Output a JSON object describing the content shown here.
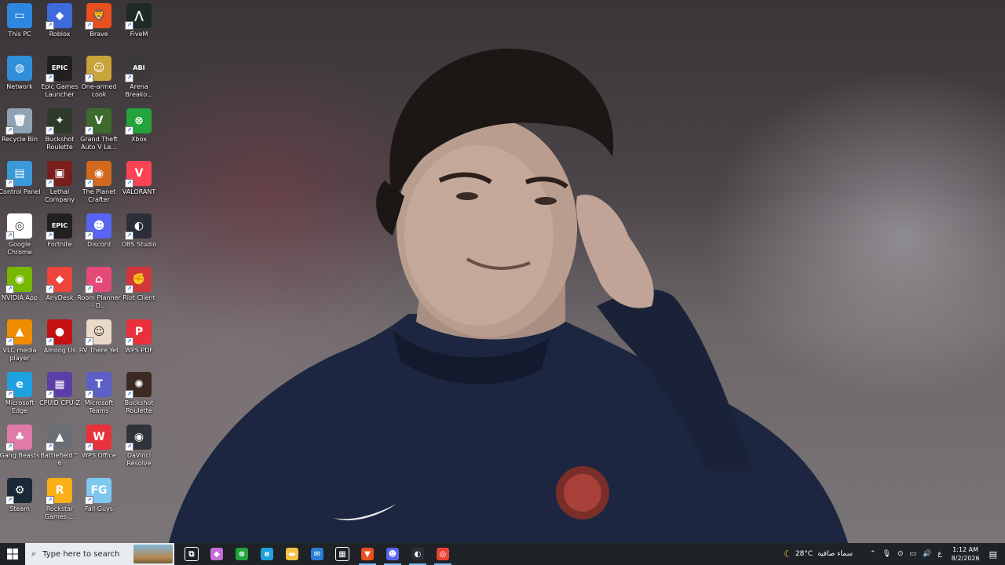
{
  "desktop": {
    "icons": [
      {
        "label": "This PC",
        "icon": "this-pc-icon",
        "color": "#2e86de",
        "glyph": "▭"
      },
      {
        "label": "Roblox",
        "icon": "roblox-icon",
        "color": "#3d6bdb",
        "glyph": "◆"
      },
      {
        "label": "Brave",
        "icon": "brave-icon",
        "color": "#e8501e",
        "glyph": "🦁"
      },
      {
        "label": "FiveM",
        "icon": "fivem-icon",
        "color": "#1d2a25",
        "glyph": "⋀"
      },
      {
        "label": "Network",
        "icon": "network-icon",
        "color": "#2f8fd8",
        "glyph": "◍"
      },
      {
        "label": "Epic Games Launcher",
        "icon": "epic-games-icon",
        "color": "#202020",
        "glyph": "EPIC"
      },
      {
        "label": "One-armed cook",
        "icon": "one-armed-cook-icon",
        "color": "#c9a43a",
        "glyph": "☺"
      },
      {
        "label": "Arena Breako...",
        "icon": "arena-breakout-icon",
        "color": "#3a3a3a",
        "glyph": "ABI"
      },
      {
        "label": "Recycle Bin",
        "icon": "recycle-bin-icon",
        "color": "#8fa3b5",
        "glyph": "🗑"
      },
      {
        "label": "Buckshot Roulette",
        "icon": "buckshot-roulette-icon",
        "color": "#2e3a2a",
        "glyph": "✦"
      },
      {
        "label": "Grand Theft Auto V Le...",
        "icon": "gta-v-icon",
        "color": "#3c6b2d",
        "glyph": "V"
      },
      {
        "label": "Xbox",
        "icon": "xbox-icon",
        "color": "#23a33c",
        "glyph": "⊗"
      },
      {
        "label": "Control Panel",
        "icon": "control-panel-icon",
        "color": "#3a9ad9",
        "glyph": "▤"
      },
      {
        "label": "Lethal Company",
        "icon": "lethal-company-icon",
        "color": "#7a1d1d",
        "glyph": "▣"
      },
      {
        "label": "The Planet Crafter",
        "icon": "planet-crafter-icon",
        "color": "#d2691e",
        "glyph": "◉"
      },
      {
        "label": "VALORANT",
        "icon": "valorant-icon",
        "color": "#fa4454",
        "glyph": "V"
      },
      {
        "label": "Google Chrome",
        "icon": "chrome-icon",
        "color": "#ffffff",
        "glyph": "◎"
      },
      {
        "label": "Fortnite",
        "icon": "fortnite-icon",
        "color": "#202020",
        "glyph": "EPIC"
      },
      {
        "label": "Discord",
        "icon": "discord-icon",
        "color": "#5865f2",
        "glyph": "☻"
      },
      {
        "label": "OBS Studio",
        "icon": "obs-icon",
        "color": "#2b2e38",
        "glyph": "◐"
      },
      {
        "label": "NVIDIA App",
        "icon": "nvidia-icon",
        "color": "#76b900",
        "glyph": "◉"
      },
      {
        "label": "AnyDesk",
        "icon": "anydesk-icon",
        "color": "#ef443b",
        "glyph": "◆"
      },
      {
        "label": "Room Planner - D...",
        "icon": "room-planner-icon",
        "color": "#e64a79",
        "glyph": "⌂"
      },
      {
        "label": "Riot Client",
        "icon": "riot-client-icon",
        "color": "#d13639",
        "glyph": "✊"
      },
      {
        "label": "VLC media player",
        "icon": "vlc-icon",
        "color": "#f08c00",
        "glyph": "▲"
      },
      {
        "label": "Among Us",
        "icon": "among-us-icon",
        "color": "#c51111",
        "glyph": "●"
      },
      {
        "label": "RV There Yet",
        "icon": "rv-there-yet-icon",
        "color": "#e8d9c8",
        "glyph": "☺"
      },
      {
        "label": "WPS PDF",
        "icon": "wps-pdf-icon",
        "color": "#e8313a",
        "glyph": "P"
      },
      {
        "label": "Microsoft Edge",
        "icon": "edge-icon",
        "color": "#1fa1e0",
        "glyph": "e"
      },
      {
        "label": "CPUID CPU-Z",
        "icon": "cpu-z-icon",
        "color": "#5b3ea8",
        "glyph": "▦"
      },
      {
        "label": "Microsoft Teams",
        "icon": "teams-icon",
        "color": "#5b5fc7",
        "glyph": "T"
      },
      {
        "label": "Buckshot Roulette",
        "icon": "buckshot-roulette-2-icon",
        "color": "#3a2a22",
        "glyph": "✺"
      },
      {
        "label": "Gang Beasts",
        "icon": "gang-beasts-icon",
        "color": "#e07aa9",
        "glyph": "♣"
      },
      {
        "label": "Battlefield™ 6",
        "icon": "battlefield-6-icon",
        "color": "#6b6f73",
        "glyph": "▲"
      },
      {
        "label": "WPS Office",
        "icon": "wps-office-icon",
        "color": "#e8313a",
        "glyph": "W"
      },
      {
        "label": "DaVinci Resolve",
        "icon": "davinci-resolve-icon",
        "color": "#30343a",
        "glyph": "◉"
      },
      {
        "label": "Steam",
        "icon": "steam-icon",
        "color": "#1b2838",
        "glyph": "⚙"
      },
      {
        "label": "Rockstar Games ...",
        "icon": "rockstar-games-icon",
        "color": "#fcaf17",
        "glyph": "R"
      },
      {
        "label": "Fall Guys",
        "icon": "fall-guys-icon",
        "color": "#7ec8f0",
        "glyph": "FG"
      }
    ]
  },
  "taskbar": {
    "search_placeholder": "Type here to search",
    "apps": [
      {
        "name": "task-view-icon",
        "glyph": "⧉",
        "color": "#ffffff"
      },
      {
        "name": "copilot-icon",
        "glyph": "◆",
        "color": "#c86dd7"
      },
      {
        "name": "xbox-taskbar-icon",
        "glyph": "⊗",
        "color": "#23a33c"
      },
      {
        "name": "edge-taskbar-icon",
        "glyph": "e",
        "color": "#1fa1e0"
      },
      {
        "name": "file-explorer-icon",
        "glyph": "▬",
        "color": "#f5c043"
      },
      {
        "name": "mail-icon",
        "glyph": "✉",
        "color": "#2b7cd3"
      },
      {
        "name": "store-icon",
        "glyph": "▦",
        "color": "#ffffff"
      },
      {
        "name": "brave-taskbar-icon",
        "glyph": "▼",
        "color": "#e8501e"
      },
      {
        "name": "discord-taskbar-icon",
        "glyph": "☻",
        "color": "#5865f2"
      },
      {
        "name": "obs-taskbar-icon",
        "glyph": "◐",
        "color": "#2b2e38"
      },
      {
        "name": "chrome-taskbar-icon",
        "glyph": "◎",
        "color": "#ea4335"
      }
    ],
    "weather": {
      "temp": "28°C",
      "condition": "سماء صافية"
    },
    "language": "ع",
    "clock": {
      "time": "1:12 AM",
      "date": "8/2/2026"
    }
  }
}
